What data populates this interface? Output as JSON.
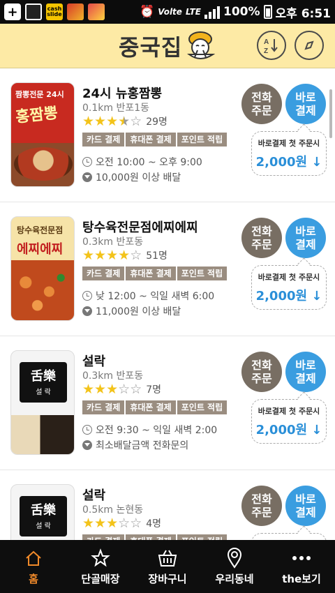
{
  "status_bar": {
    "cash_label": "cash slide",
    "network": "LTE",
    "volte": "Volte",
    "battery": "100%",
    "time": "오후 6:51"
  },
  "header": {
    "title": "중국집",
    "sort_label": "A↕B",
    "accent_color": "#fdeaa5"
  },
  "common": {
    "phone_button": "전화 주문",
    "pay_button": "바로 결제",
    "promo_label": "바로결제 첫 주문시",
    "promo_amount": "2,000원 ↓",
    "tags": [
      "카드 결제",
      "휴대폰 결제",
      "포인트 적립"
    ]
  },
  "restaurants": [
    {
      "name": "24시 뉴홍짬뽕",
      "distance": "0.1km 반포1동",
      "rating": 3.5,
      "reviews": "29명",
      "hours": "오전 10:00 ~ 오후 9:00",
      "min_order": "10,000원 이상 배달",
      "thumb_title": "짬뽕전문 24시",
      "thumb_big": "홍짬뽕"
    },
    {
      "name": "탕수육전문점에찌에찌",
      "distance": "0.3km 반포동",
      "rating": 4,
      "reviews": "51명",
      "hours": "낮 12:00 ~ 익일 새벽 6:00",
      "min_order": "11,000원 이상 배달",
      "thumb_title": "탕수육전문점",
      "thumb_big": "에찌에찌"
    },
    {
      "name": "설락",
      "distance": "0.3km 반포동",
      "rating": 3,
      "reviews": "7명",
      "hours": "오전 9:30 ~ 익일 새벽 2:00",
      "min_order": "최소배달금액 전화문의",
      "thumb_logo": "舌樂",
      "thumb_logo_sub": "설 락"
    },
    {
      "name": "설락",
      "distance": "0.5km 논현동",
      "rating": 3,
      "reviews": "4명",
      "thumb_logo": "舌樂",
      "thumb_logo_sub": "설 락"
    }
  ],
  "bottom_nav": [
    {
      "label": "홈",
      "icon": "home-icon",
      "active": true
    },
    {
      "label": "단골매장",
      "icon": "star-outline-icon"
    },
    {
      "label": "장바구니",
      "icon": "basket-icon"
    },
    {
      "label": "우리동네",
      "icon": "location-pin-icon"
    },
    {
      "label": "the보기",
      "icon": "more-dots-icon"
    }
  ],
  "colors": {
    "phone_button": "#786e63",
    "pay_button": "#3a9de0",
    "tag": "#9a8d80",
    "star": "#f3c31a",
    "nav_active": "#f08a2a"
  }
}
